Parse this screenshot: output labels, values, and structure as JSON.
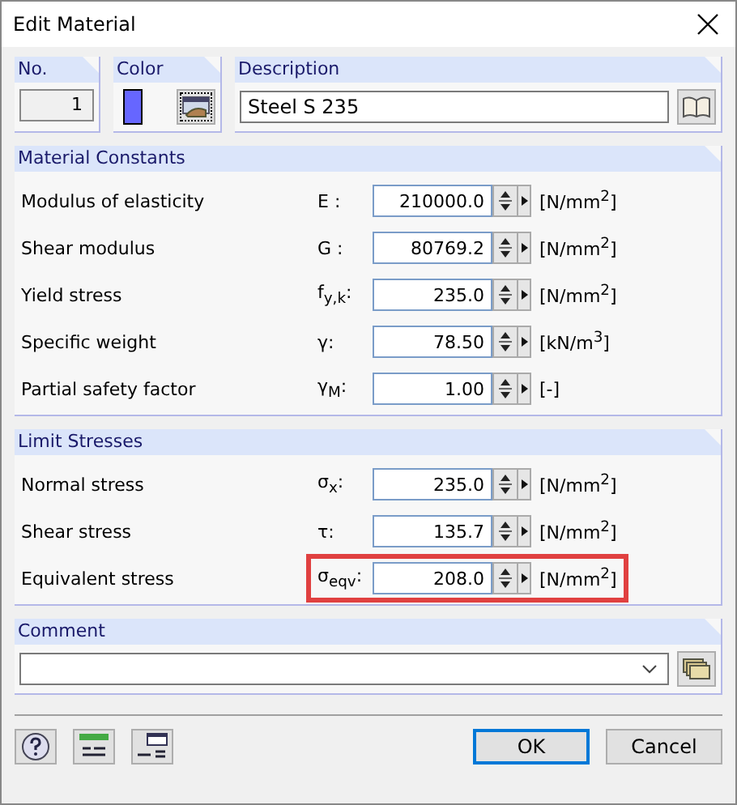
{
  "window": {
    "title": "Edit Material"
  },
  "header": {
    "number": {
      "label": "No.",
      "value": "1"
    },
    "color": {
      "label": "Color",
      "color": "#6666ff"
    },
    "description": {
      "label": "Description",
      "value": "Steel S 235"
    }
  },
  "groups": [
    {
      "title": "Material Constants",
      "rows": [
        {
          "label": "Modulus of elasticity",
          "symbol": "E :",
          "value": "210000.0",
          "unit": "[N/mm$^{2}$]",
          "highlighted": false
        },
        {
          "label": "Shear modulus",
          "symbol": "G :",
          "value": "80769.2",
          "unit": "[N/mm$^{2}$]",
          "highlighted": false
        },
        {
          "label": "Yield stress",
          "symbol": "f$_{y,k}$:",
          "value": "235.0",
          "unit": "[N/mm$^{2}$]",
          "highlighted": false
        },
        {
          "label": "Specific weight",
          "symbol": "γ:",
          "value": "78.50",
          "unit": "[kN/m$^{3}$]",
          "highlighted": false
        },
        {
          "label": "Partial safety factor",
          "symbol": "γ$_{M}$:",
          "value": "1.00",
          "unit": "[-]",
          "highlighted": false
        }
      ]
    },
    {
      "title": "Limit Stresses",
      "rows": [
        {
          "label": "Normal stress",
          "symbol": "σ$_{x}$:",
          "value": "235.0",
          "unit": "[N/mm$^{2}$]",
          "highlighted": false
        },
        {
          "label": "Shear stress",
          "symbol": "τ:",
          "value": "135.7",
          "unit": "[N/mm$^{2}$]",
          "highlighted": false
        },
        {
          "label": "Equivalent stress",
          "symbol": "σ$_{eqv}$:",
          "value": "208.0",
          "unit": "[N/mm$^{2}$]",
          "highlighted": true
        }
      ]
    }
  ],
  "comment": {
    "label": "Comment"
  },
  "buttons": [
    {
      "label": "OK",
      "default": true
    },
    {
      "label": "Cancel",
      "default": false
    }
  ]
}
